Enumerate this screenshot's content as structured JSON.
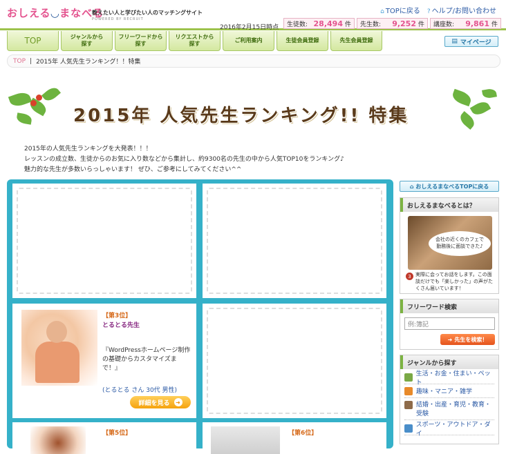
{
  "header": {
    "logo": "おしえる",
    "logo_face": "◡",
    "logo2": "まなべる",
    "tagline": "教えたい人と学びたい人のマッチングサイト",
    "powered": "POWERED BY RECRUIT",
    "link_top": "TOPに戻る",
    "link_help": "ヘルプ/お問い合わせ",
    "as_of": "2016年2月15日時点",
    "stats": [
      {
        "label": "生徒数:",
        "num": "28,494",
        "unit": "件"
      },
      {
        "label": "先生数:",
        "num": "9,252",
        "unit": "件"
      },
      {
        "label": "講座数:",
        "num": "9,861",
        "unit": "件"
      }
    ]
  },
  "nav": [
    "TOP",
    "ジャンルから\n探す",
    "フリーワードから\n探す",
    "リクエストから\n探す",
    "ご利用案内",
    "生徒会員登録",
    "先生会員登録"
  ],
  "mypage": "マイページ",
  "crumbs": {
    "top": "TOP",
    "sep": "|",
    "current": "2015年 人気先生ランキング！！特集"
  },
  "banner_title": "2015年 人気先生ランキング!! 特集",
  "intro": [
    "2015年の人気先生ランキングを大発表！！！",
    "レッスンの成立数、生徒からのお気に入り数などから集計し、約9300名の先生の中から人気TOP10をランキング♪",
    "魅力的な先生が多数いらっしゃいます！ ぜひ、ご参考にしてみてください^^"
  ],
  "rank3": {
    "rank": "【第3位】",
    "name": "とるとる先生",
    "desc": "『WordPressホームページ制作の基礎からカスタマイズまで！』",
    "meta": "(とるとる さん 30代 男性)",
    "button": "詳細を見る"
  },
  "rank5": {
    "rank": "【第5位】"
  },
  "rank6": {
    "rank": "【第6位】"
  },
  "sidebar": {
    "top_btn": "おしえるまなべるTOPに戻る",
    "about_h": "おしえるまなべるとは？",
    "about_bubble": "会社の近くのカフェで\n勤務後に面談できた♪",
    "about_num": "3",
    "about_txt": "実際に会ってお話をします。この面談だけでも「楽しかった」の声がたくさん届いています！",
    "search_h": "フリーワード検索",
    "search_placeholder": "例:簿記",
    "search_btn": "先生を検索！",
    "genre_h": "ジャンルから探す",
    "genres": [
      "生活・お金・住まい・ペット",
      "趣味・マニア・雑学",
      "結婚・出産・育児・教育・受験",
      "スポーツ・アウトドア・ダイ"
    ]
  }
}
